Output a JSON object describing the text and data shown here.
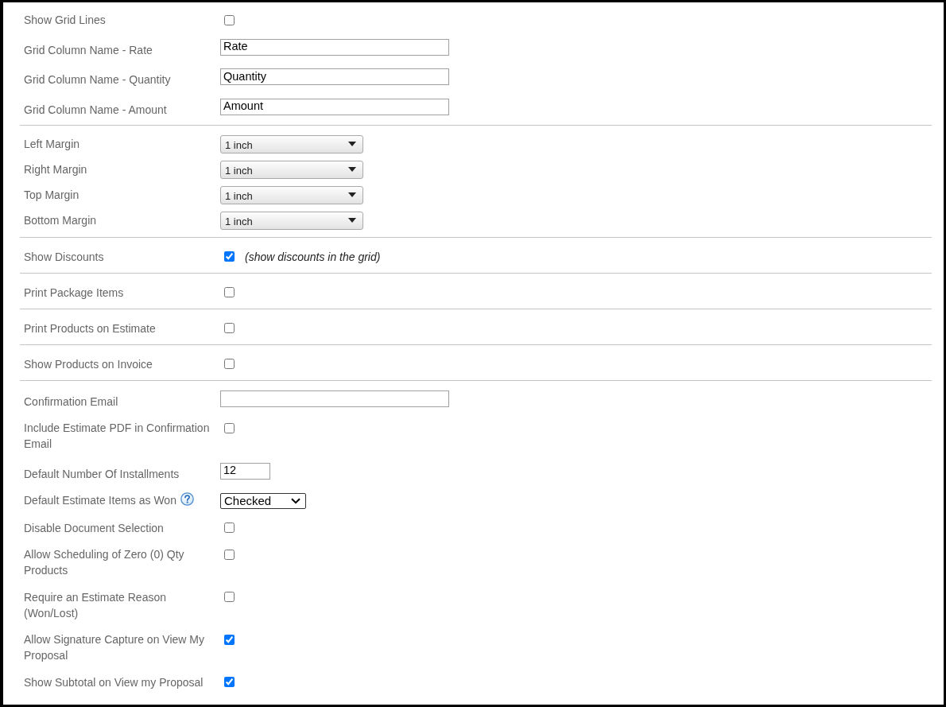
{
  "sections": [
    {
      "rows": [
        {
          "kind": "checkbox",
          "label": "Show Grid Lines",
          "checked": false
        },
        {
          "kind": "text",
          "label": "Grid Column Name - Rate",
          "value": "Rate"
        },
        {
          "kind": "text",
          "label": "Grid Column Name - Quantity",
          "value": "Quantity"
        },
        {
          "kind": "text",
          "label": "Grid Column Name - Amount",
          "value": "Amount"
        }
      ]
    },
    {
      "rows": [
        {
          "kind": "dropdown",
          "label": "Left Margin",
          "value": "1 inch"
        },
        {
          "kind": "dropdown",
          "label": "Right Margin",
          "value": "1 inch"
        },
        {
          "kind": "dropdown",
          "label": "Top Margin",
          "value": "1 inch"
        },
        {
          "kind": "dropdown",
          "label": "Bottom Margin",
          "value": "1 inch"
        }
      ]
    },
    {
      "rows": [
        {
          "kind": "checkbox",
          "label": "Show Discounts",
          "checked": true,
          "note": "(show discounts in the grid)"
        }
      ]
    },
    {
      "rows": [
        {
          "kind": "checkbox",
          "label": "Print Package Items",
          "checked": false
        }
      ]
    },
    {
      "rows": [
        {
          "kind": "checkbox",
          "label": "Print Products on Estimate",
          "checked": false
        }
      ]
    },
    {
      "rows": [
        {
          "kind": "checkbox",
          "label": "Show Products on Invoice",
          "checked": false
        }
      ]
    },
    {
      "rows": [
        {
          "kind": "text",
          "label": "Confirmation Email"
        },
        {
          "kind": "checkbox",
          "label": "Include Estimate PDF in Confirmation Email",
          "checked": false
        },
        {
          "kind": "number",
          "label": "Default Number Of Installments",
          "value": "12"
        },
        {
          "kind": "select",
          "label": "Default Estimate Items as Won",
          "help": true,
          "value": "Checked"
        },
        {
          "kind": "checkbox",
          "label": "Disable Document Selection",
          "checked": false
        },
        {
          "kind": "checkbox",
          "label": "Allow Scheduling of Zero (0) Qty Products",
          "checked": false
        },
        {
          "kind": "checkbox",
          "label": "Require an Estimate Reason (Won/Lost)",
          "checked": false
        },
        {
          "kind": "checkbox",
          "label": "Allow Signature Capture on View My Proposal",
          "checked": true
        },
        {
          "kind": "checkbox",
          "label": "Show Subtotal on View my Proposal",
          "checked": true
        }
      ]
    }
  ]
}
